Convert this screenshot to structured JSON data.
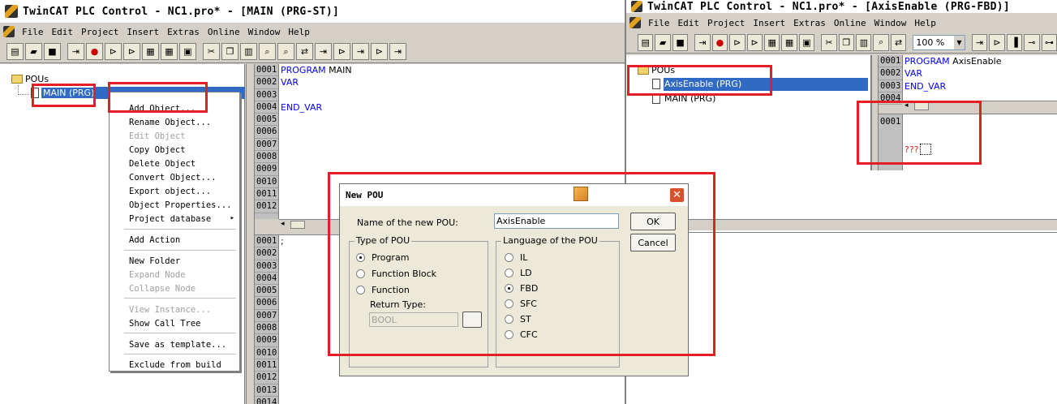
{
  "left_window": {
    "title": "TwinCAT PLC Control - NC1.pro* - [MAIN (PRG-ST)]",
    "menu": [
      "File",
      "Edit",
      "Project",
      "Insert",
      "Extras",
      "Online",
      "Window",
      "Help"
    ],
    "tree": {
      "root": "POUs",
      "items": [
        "MAIN (PRG)"
      ]
    },
    "editor_decl_lines": [
      "0001",
      "0002",
      "0003",
      "0004",
      "0005",
      "0006",
      "0007",
      "0008",
      "0009",
      "0010",
      "0011",
      "0012"
    ],
    "editor_decl_code": [
      "PROGRAM MAIN",
      "VAR",
      "",
      "END_VAR"
    ],
    "editor_body_lines": [
      "0001",
      "0002",
      "0003",
      "0004",
      "0005",
      "0006",
      "0007",
      "0008",
      "0009",
      "0010",
      "0011",
      "0012",
      "0013",
      "0014"
    ],
    "editor_body_code": [
      ";"
    ]
  },
  "context_menu": {
    "items": [
      {
        "label": "Add Object...",
        "disabled": false
      },
      {
        "label": "Rename Object...",
        "disabled": false
      },
      {
        "label": "Edit Object",
        "disabled": true
      },
      {
        "label": "Copy Object",
        "disabled": false
      },
      {
        "label": "Delete Object",
        "disabled": false
      },
      {
        "label": "Convert Object...",
        "disabled": false
      },
      {
        "label": "Export object...",
        "disabled": false
      },
      {
        "label": "Object Properties...",
        "disabled": false
      },
      {
        "label": "Project database",
        "disabled": false,
        "submenu": true
      },
      {
        "label": "Add Action",
        "disabled": false
      },
      {
        "label": "New Folder",
        "disabled": false
      },
      {
        "label": "Expand Node",
        "disabled": true
      },
      {
        "label": "Collapse Node",
        "disabled": true
      },
      {
        "label": "View Instance...",
        "disabled": true
      },
      {
        "label": "Show Call Tree",
        "disabled": false
      },
      {
        "label": "Save as template...",
        "disabled": false
      },
      {
        "label": "Exclude from build",
        "disabled": false
      }
    ],
    "submenu_arrow": "▸"
  },
  "right_window": {
    "title": "TwinCAT PLC Control - NC1.pro* - [AxisEnable (PRG-FBD)]",
    "menu": [
      "File",
      "Edit",
      "Project",
      "Insert",
      "Extras",
      "Online",
      "Window",
      "Help"
    ],
    "zoom": "100 %",
    "tree": {
      "root": "POUs",
      "items": [
        "AxisEnable (PRG)",
        "MAIN (PRG)"
      ]
    },
    "editor_decl_lines": [
      "0001",
      "0002",
      "0003",
      "0004"
    ],
    "editor_decl_code": [
      "PROGRAM AxisEnable",
      "VAR",
      "END_VAR"
    ],
    "network_number": "0001",
    "network_placeholder": "???"
  },
  "dialog": {
    "title": "New POU",
    "name_label": "Name of the new POU:",
    "name_value": "AxisEnable",
    "ok": "OK",
    "cancel": "Cancel",
    "type_group": "Type of POU",
    "types": [
      {
        "label": "Program",
        "selected": true
      },
      {
        "label": "Function Block",
        "selected": false
      },
      {
        "label": "Function",
        "selected": false
      }
    ],
    "return_type_label": "Return Type:",
    "return_type_value": "BOOL",
    "lang_group": "Language of the POU",
    "languages": [
      {
        "label": "IL",
        "selected": false
      },
      {
        "label": "LD",
        "selected": false
      },
      {
        "label": "FBD",
        "selected": true
      },
      {
        "label": "SFC",
        "selected": false
      },
      {
        "label": "ST",
        "selected": false
      },
      {
        "label": "CFC",
        "selected": false
      }
    ]
  },
  "colors": {
    "highlight": "#e31e25",
    "selection": "#316ac5",
    "keyword": "#0000ff"
  }
}
